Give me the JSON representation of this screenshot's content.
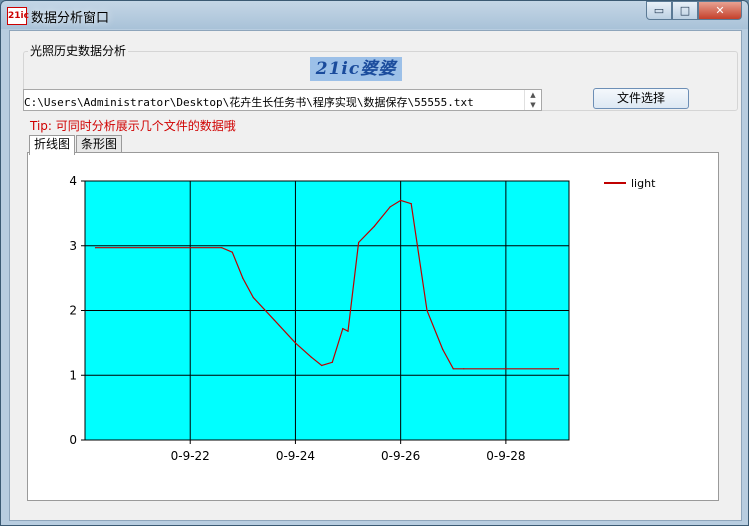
{
  "window": {
    "app_icon": "21ic",
    "title": "数据分析窗口",
    "minimize_glyph": "▭",
    "maximize_glyph": "□",
    "close_glyph": "✕"
  },
  "group": {
    "label": "光照历史数据分析",
    "logo": "21ic婆婆"
  },
  "file": {
    "path": "C:\\Users\\Administrator\\Desktop\\花卉生长任务书\\程序实现\\数据保存\\55555.txt",
    "button": "文件选择",
    "scroll_up": "▲",
    "scroll_down": "▼"
  },
  "tip": "Tip: 可同时分析展示几个文件的数据哦",
  "tabs": [
    "折线图",
    "条形图"
  ],
  "colors": {
    "plot_bg": "#00ffff",
    "line": "#c00000"
  },
  "chart_data": {
    "type": "line",
    "title": "",
    "xlabel": "",
    "ylabel": "",
    "ylim": [
      0,
      4
    ],
    "y_ticks": [
      "0",
      "1",
      "2",
      "3",
      "4"
    ],
    "x_ticks": [
      "0-9-22",
      "0-9-24",
      "0-9-26",
      "0-9-28"
    ],
    "grid": true,
    "legend_position": "top-right",
    "series": [
      {
        "name": "light",
        "x": [
          0.2,
          2.6,
          2.8,
          3.0,
          3.2,
          3.6,
          4.0,
          4.3,
          4.5,
          4.7,
          4.9,
          5.0,
          5.2,
          5.5,
          5.8,
          6.0,
          6.2,
          6.5,
          6.8,
          7.0,
          7.2,
          8.0,
          9.0,
          9.0
        ],
        "y": [
          2.97,
          2.97,
          2.9,
          2.5,
          2.2,
          1.85,
          1.5,
          1.28,
          1.15,
          1.2,
          1.72,
          1.68,
          3.05,
          3.3,
          3.6,
          3.7,
          3.65,
          2.0,
          1.4,
          1.1,
          1.1,
          1.1,
          1.1,
          1.1
        ]
      }
    ]
  }
}
